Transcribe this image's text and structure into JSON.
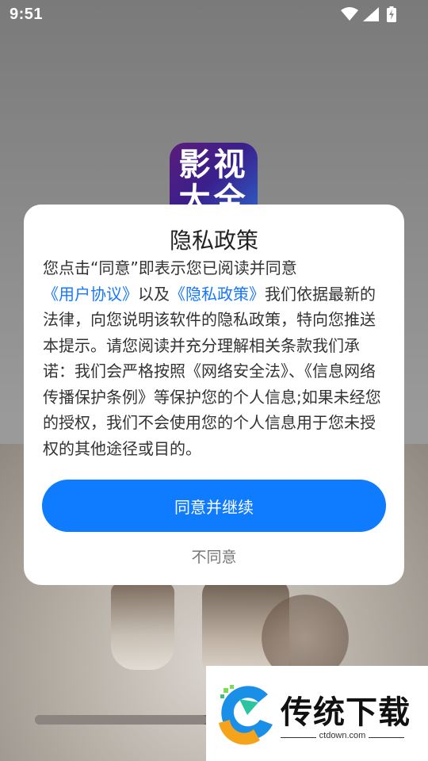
{
  "status_bar": {
    "time": "9:51"
  },
  "app_icon": {
    "text_line1": "影视",
    "text_line2": "大全"
  },
  "dialog": {
    "title": "隐私政策",
    "body_segments": [
      {
        "text": "您点击“同意”即表示您已阅读并同意",
        "link": false
      },
      {
        "text": "《用户协议》",
        "link": true
      },
      {
        "text": "以及",
        "link": false
      },
      {
        "text": "《隐私政策》",
        "link": true
      },
      {
        "text": "我们依据最新的法律，向您说明该软件的隐私政策，特向您推送本提示。请您阅读并充分理解相关条款我们承诺：我们会严格按照《网络安全法》、《信息网络传播保护条例》等保护您的个人信息;如果未经您的授权，我们不会使用您的个人信息用于您未授权的其他途径或目的。",
        "link": false
      }
    ],
    "agree_label": "同意并继续",
    "disagree_label": "不同意"
  },
  "progress": {
    "fraction": 0.48
  },
  "watermark": {
    "brand": "传统下载",
    "url": "ctdown.com"
  },
  "colors": {
    "accent": "#0f7bff",
    "link": "#1677ff"
  }
}
